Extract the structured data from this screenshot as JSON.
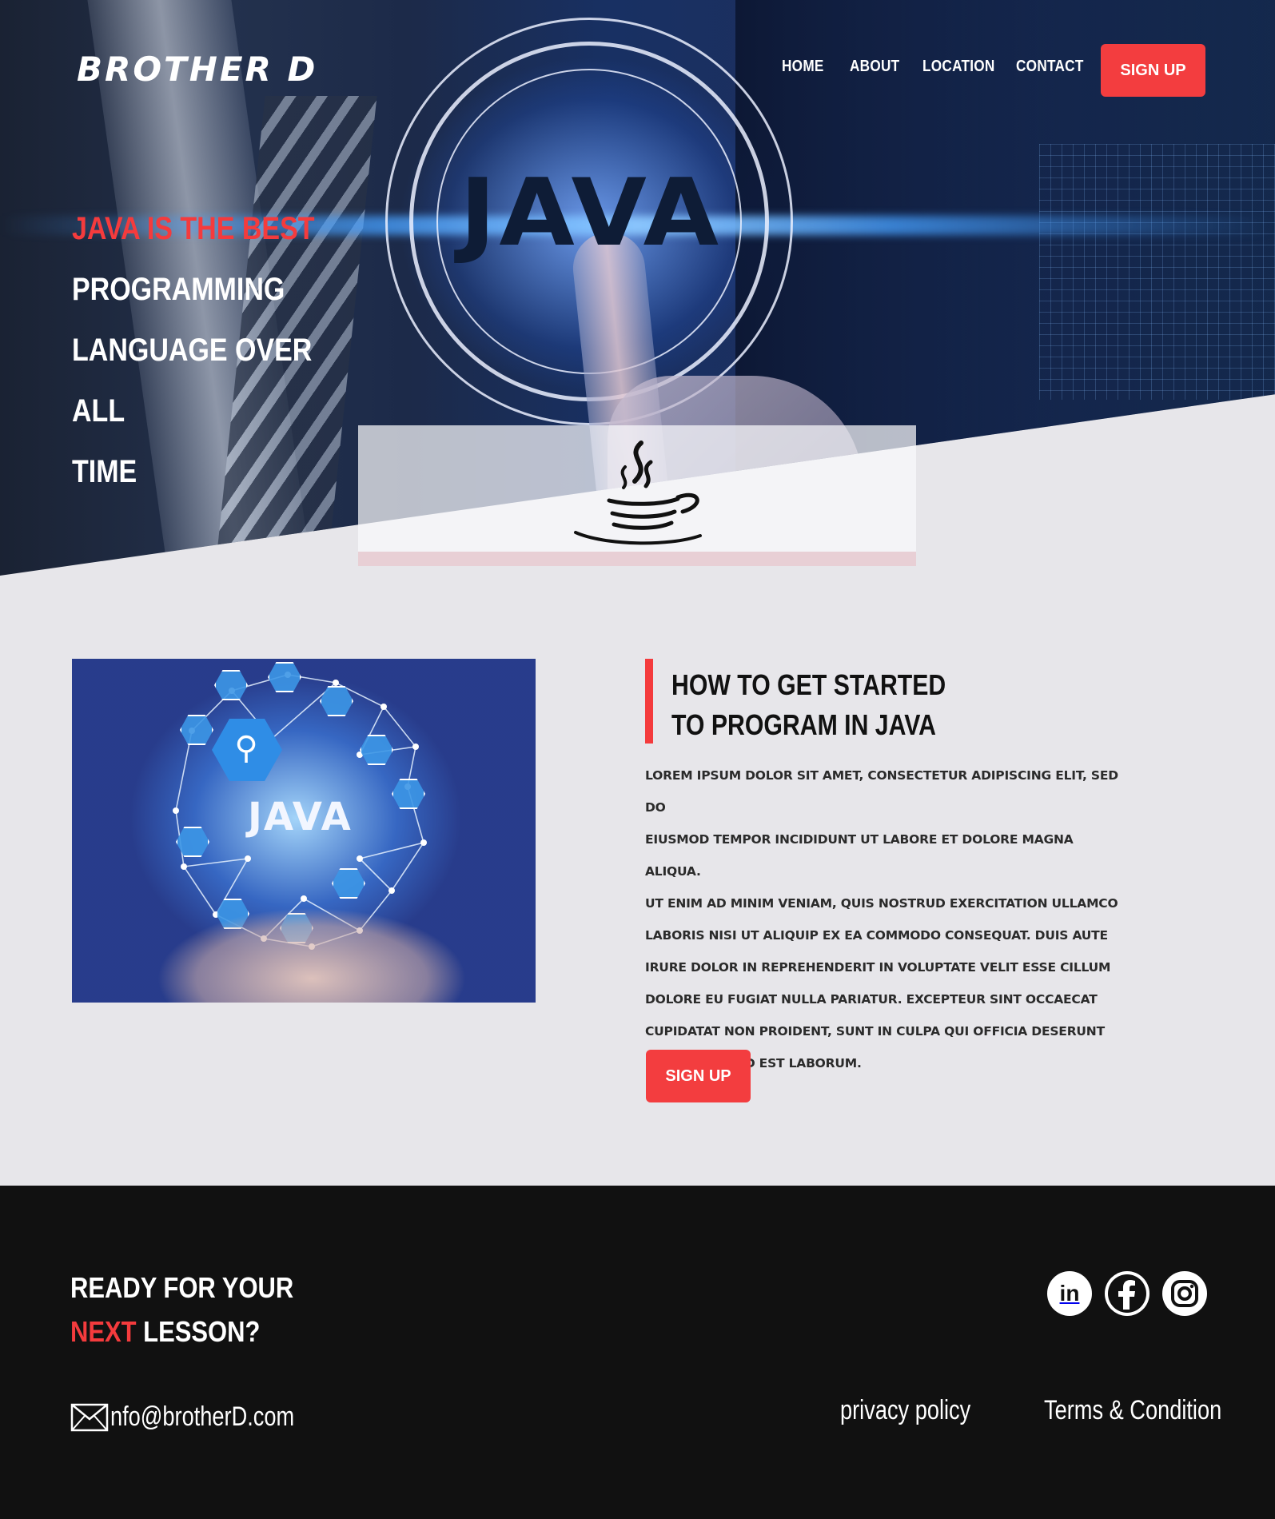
{
  "brand": {
    "logo_text": "BROTHER D"
  },
  "nav": {
    "items": [
      {
        "label": "HOME"
      },
      {
        "label": "ABOUT"
      },
      {
        "label": "LOCATION"
      },
      {
        "label": "CONTACT"
      }
    ],
    "signup_label": "SIGN UP"
  },
  "hero": {
    "image_text": "JAVA",
    "headline_red": "JAVA IS THE  BEST",
    "headline_lines": [
      "PROGRAMMING",
      "LANGUAGE OVER ALL",
      "TIME"
    ],
    "logo_icon": "java-cup-icon"
  },
  "intro": {
    "image_text": "JAVA",
    "title_lines": [
      "HOW TO GET STARTED",
      "TO PROGRAM IN JAVA"
    ],
    "body_lines": [
      "LOREM IPSUM DOLOR SIT AMET, CONSECTETUR ADIPISCING ELIT, SED DO",
      "EIUSMOD TEMPOR INCIDIDUNT UT LABORE ET DOLORE MAGNA ALIQUA.",
      "UT ENIM AD MINIM VENIAM, QUIS NOSTRUD EXERCITATION ULLAMCO",
      "LABORIS NISI UT ALIQUIP EX EA COMMODO CONSEQUAT. DUIS AUTE",
      "IRURE DOLOR IN REPREHENDERIT IN VOLUPTATE VELIT ESSE CILLUM",
      "DOLORE EU FUGIAT NULLA PARIATUR. EXCEPTEUR SINT OCCAECAT",
      "CUPIDATAT NON PROIDENT, SUNT IN CULPA QUI OFFICIA DESERUNT",
      "MOLLIT ANIM ID EST LABORUM."
    ],
    "signup_label": "SIGN UP"
  },
  "footer": {
    "cta_line1": "READY FOR YOUR",
    "cta_red": "NEXT",
    "cta_rest": " LESSON?",
    "email": "nfo@brotherD.com",
    "email_icon": "mail-icon",
    "social_icons": [
      "linkedin-icon",
      "facebook-icon",
      "instagram-icon"
    ],
    "linkedin_text": "in",
    "links": {
      "privacy": "privacy policy",
      "terms": "Terms & Condition"
    }
  },
  "colors": {
    "accent": "#f33d3f",
    "page_bg": "#e7e6ea",
    "footer_bg": "#111111"
  }
}
